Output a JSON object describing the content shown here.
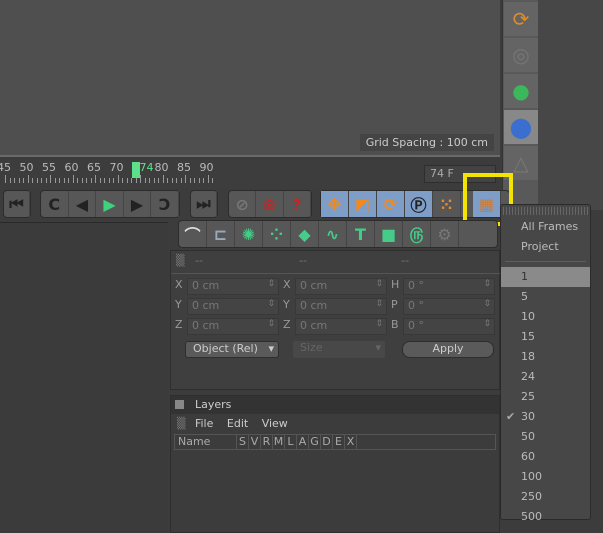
{
  "viewport": {
    "grid_spacing": "Grid Spacing : 100 cm"
  },
  "timeline": {
    "ticks": [
      "45",
      "50",
      "55",
      "60",
      "65",
      "70",
      "74",
      "80",
      "85",
      "90"
    ],
    "current_frame": "74 F",
    "current": 74
  },
  "transport": {
    "buttons": [
      "go-to-start",
      "previous-key",
      "previous-frame",
      "play",
      "next-frame",
      "next-key",
      "go-to-end"
    ]
  },
  "coords": {
    "headers": [
      "--",
      "--",
      "--"
    ],
    "rows": [
      {
        "a": "X",
        "av": "0 cm",
        "b": "X",
        "bv": "0 cm",
        "c": "H",
        "cv": "0 °"
      },
      {
        "a": "Y",
        "av": "0 cm",
        "b": "Y",
        "bv": "0 cm",
        "c": "P",
        "cv": "0 °"
      },
      {
        "a": "Z",
        "av": "0 cm",
        "b": "Z",
        "bv": "0 cm",
        "c": "B",
        "cv": "0 °"
      }
    ],
    "mode": "Object (Rel)",
    "size": "Size",
    "apply": "Apply"
  },
  "layers": {
    "title": "Layers",
    "menu": [
      "File",
      "Edit",
      "View"
    ],
    "columns": [
      "Name",
      "S",
      "V",
      "R",
      "M",
      "L",
      "A",
      "G",
      "D",
      "E",
      "X"
    ]
  },
  "menu": {
    "items": [
      "All Frames",
      "Project"
    ],
    "fps": [
      "1",
      "5",
      "10",
      "15",
      "18",
      "24",
      "25",
      "30",
      "50",
      "60",
      "100",
      "250",
      "500"
    ],
    "highlighted": "1",
    "checked": "30"
  },
  "colors": {
    "highlight": "#f2e400",
    "accent": "#5ee08a"
  }
}
